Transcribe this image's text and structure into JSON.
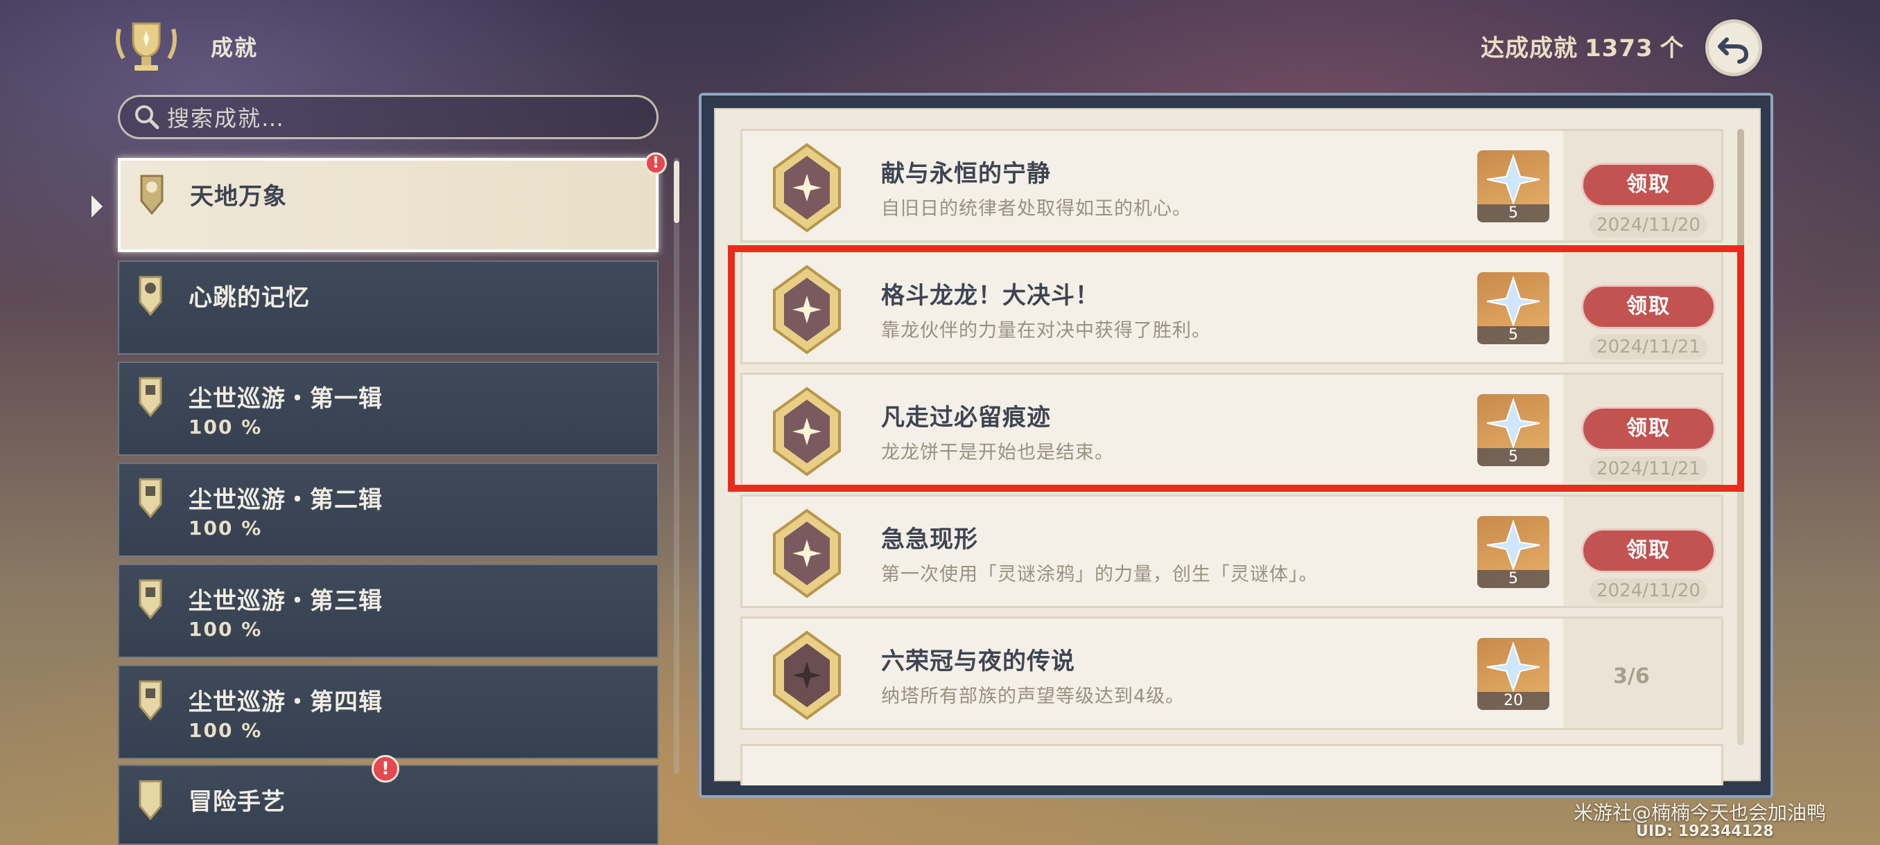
{
  "header": {
    "title": "成就",
    "count_label": "达成成就",
    "count_value": "1373",
    "count_unit": "个"
  },
  "search": {
    "placeholder": "搜索成就…"
  },
  "sidebar": {
    "items": [
      {
        "label": "天地万象",
        "pct": "",
        "active": true
      },
      {
        "label": "心跳的记忆",
        "pct": ""
      },
      {
        "label": "尘世巡游・第一辑",
        "pct": "100 %"
      },
      {
        "label": "尘世巡游・第二辑",
        "pct": "100 %"
      },
      {
        "label": "尘世巡游・第三辑",
        "pct": "100 %"
      },
      {
        "label": "尘世巡游・第四辑",
        "pct": "100 %"
      },
      {
        "label": "冒险手艺",
        "pct": ""
      }
    ],
    "badge_text": "!"
  },
  "achievements": [
    {
      "title": "献与永恒的宁静",
      "desc": "自旧日的统律者处取得如玉的机心。",
      "reward": "5",
      "claim": "领取",
      "date": "2024/11/20"
    },
    {
      "title": "格斗龙龙！大决斗！",
      "desc": "靠龙伙伴的力量在对决中获得了胜利。",
      "reward": "5",
      "claim": "领取",
      "date": "2024/11/21"
    },
    {
      "title": "凡走过必留痕迹",
      "desc": "龙龙饼干是开始也是结束。",
      "reward": "5",
      "claim": "领取",
      "date": "2024/11/21"
    },
    {
      "title": "急急现形",
      "desc": "第一次使用「灵谜涂鸦」的力量，创生「灵谜体」。",
      "reward": "5",
      "claim": "领取",
      "date": "2024/11/20"
    },
    {
      "title": "六荣冠与夜的传说",
      "desc": "纳塔所有部族的声望等级达到4级。",
      "reward": "20",
      "progress": "3/6"
    }
  ],
  "footer": {
    "watermark": "米游社@楠楠今天也会加油鸭",
    "uid": "UID: 192344128"
  },
  "colors": {
    "claim_button": "#c25350",
    "highlight": "#ec2a1b",
    "panel": "#efe9dd"
  },
  "icons": [
    "trophy-icon",
    "back-arrow-icon",
    "search-icon",
    "primogem-icon",
    "achievement-medal-icon"
  ]
}
